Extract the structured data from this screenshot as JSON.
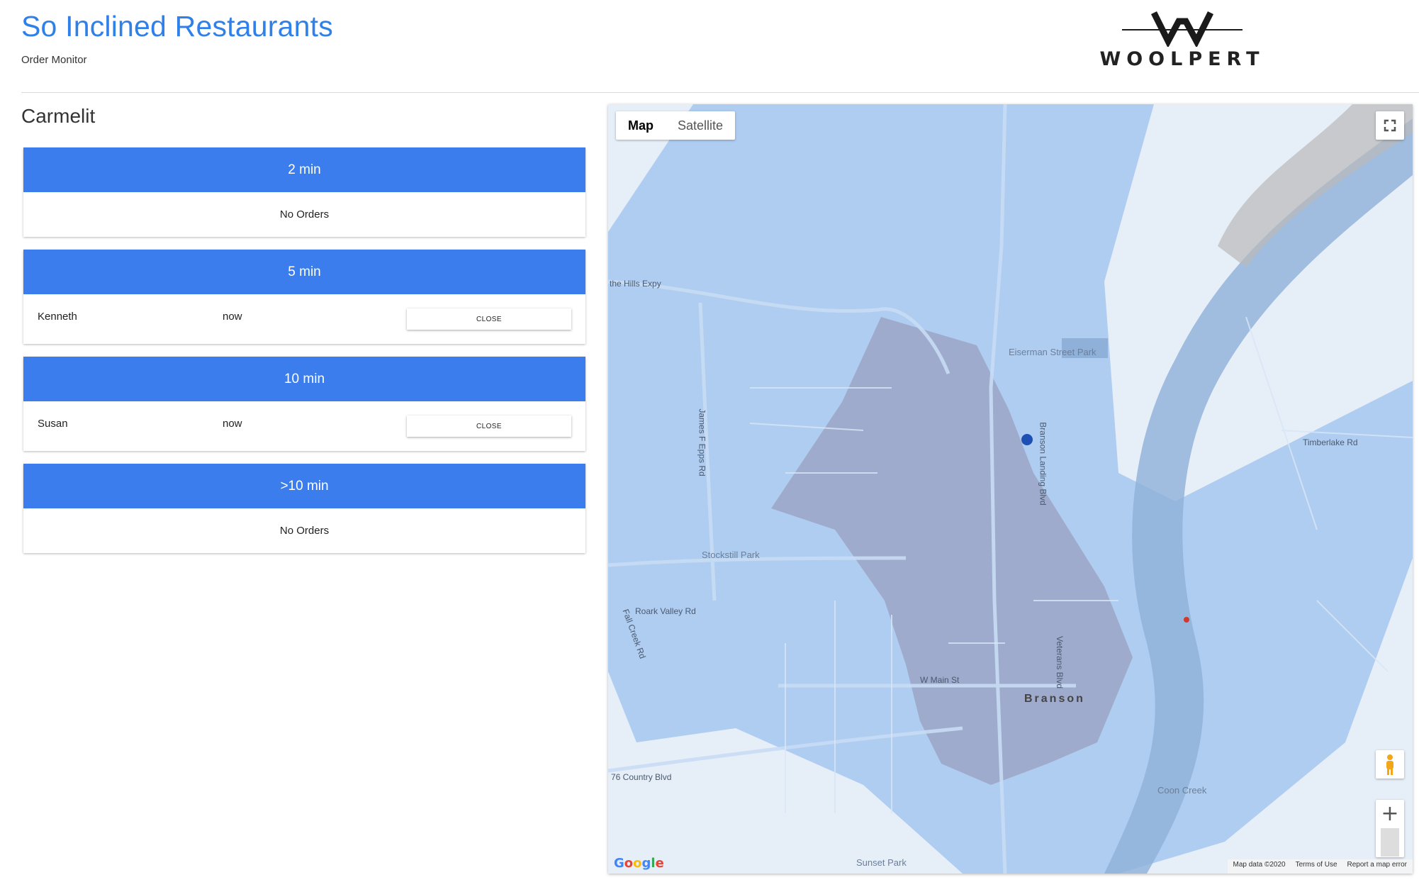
{
  "header": {
    "title": "So Inclined Restaurants",
    "subtitle": "Order Monitor",
    "logo_text": "WOOLPERT"
  },
  "location": {
    "name": "Carmelit"
  },
  "buckets": [
    {
      "label": "2 min",
      "orders": [],
      "empty_text": "No Orders"
    },
    {
      "label": "5 min",
      "orders": [
        {
          "name": "Kenneth",
          "time": "now",
          "action": "CLOSE"
        }
      ]
    },
    {
      "label": "10 min",
      "orders": [
        {
          "name": "Susan",
          "time": "now",
          "action": "CLOSE"
        }
      ]
    },
    {
      "label": ">10 min",
      "orders": [],
      "empty_text": "No Orders"
    }
  ],
  "map": {
    "type_controls": [
      "Map",
      "Satellite"
    ],
    "active_type": "Map",
    "google_logo": "Google",
    "attribution": [
      "Map data ©2020",
      "Terms of Use",
      "Report a map error"
    ],
    "labels": [
      "Eiserman Street Park",
      "Branson",
      "Stockstill Park",
      "Sunset Park",
      "Coon Creek",
      "W Main St",
      "Roark Valley Rd",
      "James F Epps Rd",
      "Veterans Blvd",
      "Branson Landing Blvd",
      "76 Country Blvd",
      "Fall Creek Rd",
      "the Hills Expy",
      "Timberlake Rd"
    ],
    "colors": {
      "outer_zone": "#a8c9f0",
      "inner_zone": "#9a9fbf",
      "water": "#8fb0d8",
      "marker": "#1e4fb3",
      "pin": "#d0392b"
    }
  }
}
